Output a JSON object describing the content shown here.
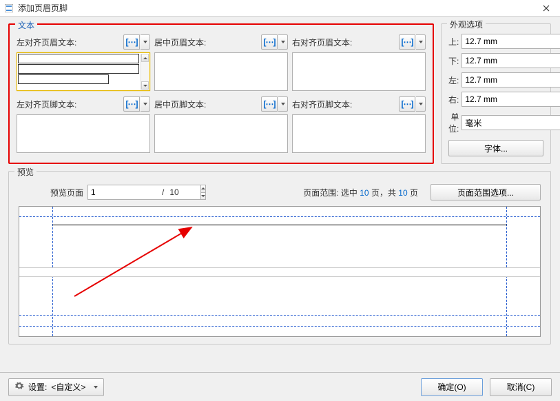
{
  "window": {
    "title": "添加页眉页脚"
  },
  "text_section": {
    "title": "文本",
    "header_left_label": "左对齐页眉文本:",
    "header_center_label": "居中页眉文本:",
    "header_right_label": "右对齐页眉文本:",
    "footer_left_label": "左对齐页脚文本:",
    "footer_center_label": "居中页脚文本:",
    "footer_right_label": "右对齐页脚文本:",
    "macro_symbol": "[⋯]"
  },
  "appearance": {
    "title": "外观选项",
    "top_label": "上:",
    "bottom_label": "下:",
    "left_label": "左:",
    "right_label": "右:",
    "top_value": "12.7 mm",
    "bottom_value": "12.7 mm",
    "left_value": "12.7 mm",
    "right_value": "12.7 mm",
    "unit_label": "单位:",
    "unit_value": "毫米",
    "font_button": "字体..."
  },
  "preview": {
    "title": "预览",
    "page_label": "预览页面",
    "page_value": "1",
    "total_pages": "10",
    "slash": "/",
    "range_prefix": "页面范围: ",
    "range_sel_label": "选中 ",
    "range_sel_value": "10",
    "range_sel_suffix": " 页",
    "range_sep": "，共 ",
    "range_total_value": "10",
    "range_total_suffix": " 页",
    "range_button": "页面范围选项..."
  },
  "bottom": {
    "settings_label": "设置: ",
    "settings_value": "<自定义>",
    "ok": "确定(O)",
    "cancel": "取消(C)"
  }
}
